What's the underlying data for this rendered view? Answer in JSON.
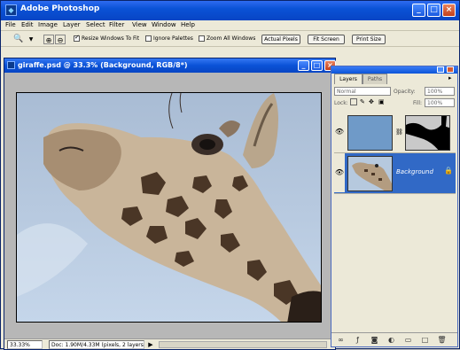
{
  "app": {
    "title": "Adobe Photoshop",
    "logo_letters": "Ps",
    "minimize": "_",
    "maximize": "□",
    "close": "×"
  },
  "menu": [
    "File",
    "Edit",
    "Image",
    "Layer",
    "Select",
    "Filter",
    "View",
    "Window",
    "Help"
  ],
  "options": {
    "resize_windows": "Resize Windows To Fit",
    "ignore_palettes": "Ignore Palettes",
    "zoom_all": "Zoom All Windows",
    "actual_pixels": "Actual Pixels",
    "fit_screen": "Fit Screen",
    "print_size": "Print Size"
  },
  "document": {
    "title": "giraffe.psd @ 33.3% (Background, RGB/8*)",
    "zoom": "33.33%",
    "doc_info": "Doc: 1.90M/4.33M (pixels, 2 layers)"
  },
  "layers_panel": {
    "tabs": [
      "Layers",
      "Paths"
    ],
    "blend_mode": "Normal",
    "opacity_label": "Opacity:",
    "opacity_value": "100%",
    "lock_label": "Lock:",
    "fill_label": "Fill:",
    "fill_value": "100%",
    "rows": [
      {
        "name": "",
        "selected": false
      },
      {
        "name": "Background",
        "selected": true
      }
    ]
  },
  "colors": {
    "titlebar": "#0a52d6",
    "panel": "#ece9d8",
    "selection": "#3169c6",
    "sky": "#b6c9de"
  }
}
